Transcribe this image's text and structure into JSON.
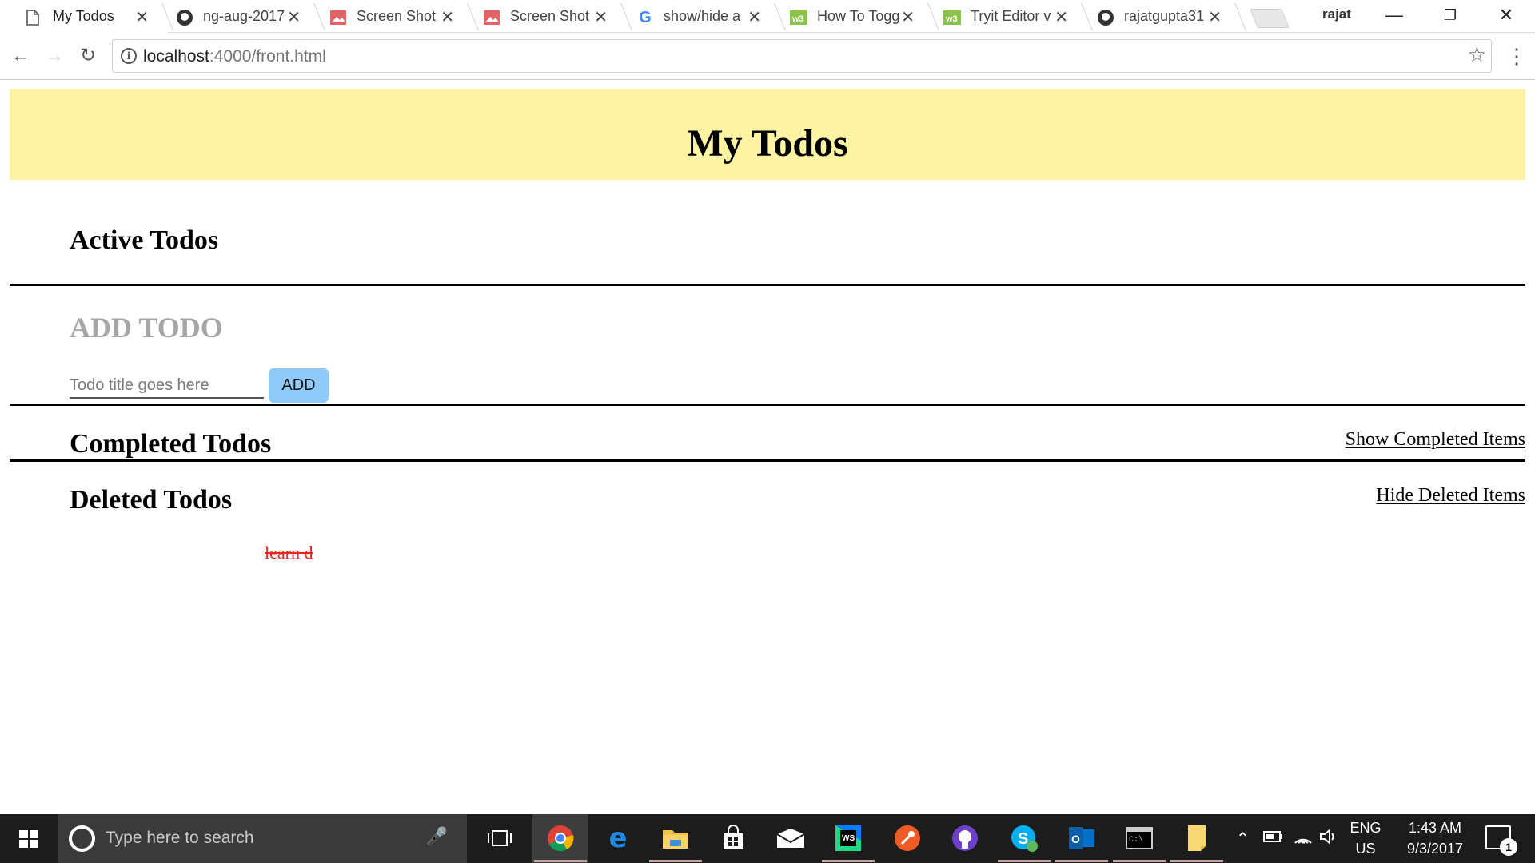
{
  "browser": {
    "tabs": [
      {
        "title": "My Todos",
        "icon": "page-icon",
        "active": true
      },
      {
        "title": "ng-aug-2017",
        "icon": "github-icon"
      },
      {
        "title": "Screen Shot",
        "icon": "image-icon"
      },
      {
        "title": "Screen Shot",
        "icon": "image-icon"
      },
      {
        "title": "show/hide a",
        "icon": "google-icon"
      },
      {
        "title": "How To Togg",
        "icon": "w3schools-icon"
      },
      {
        "title": "Tryit Editor v",
        "icon": "w3schools-icon"
      },
      {
        "title": "rajatgupta31",
        "icon": "github-icon"
      }
    ],
    "close_glyph": "✕",
    "profile_name": "rajat",
    "address": {
      "host": "localhost",
      "rest": ":4000/front.html"
    },
    "accent": "#fdf4a3"
  },
  "page": {
    "title": "My Todos",
    "active_heading": "Active Todos",
    "add_heading": "ADD TODO",
    "input_placeholder": "Todo title goes here",
    "add_button": "ADD",
    "completed_heading": "Completed Todos",
    "completed_toggle": "Show Completed Items",
    "deleted_heading": "Deleted Todos",
    "deleted_toggle": "Hide Deleted Items",
    "deleted_items": [
      "learn d"
    ],
    "colors": {
      "banner": "#fdf4a3",
      "button": "#90caf9",
      "deleted_text": "#e8261d",
      "add_heading": "#a6a6a6"
    }
  },
  "taskbar": {
    "search_placeholder": "Type here to search",
    "language": [
      "ENG",
      "US"
    ],
    "time": "1:43 AM",
    "date": "9/3/2017",
    "notification_count": "1",
    "apps": [
      "task-view-icon",
      "chrome-icon",
      "edge-icon",
      "file-explorer-icon",
      "store-icon",
      "mail-icon",
      "webstorm-icon",
      "postman-icon",
      "github-desktop-icon",
      "skype-icon",
      "outlook-icon",
      "terminal-icon",
      "sticky-notes-icon"
    ]
  }
}
